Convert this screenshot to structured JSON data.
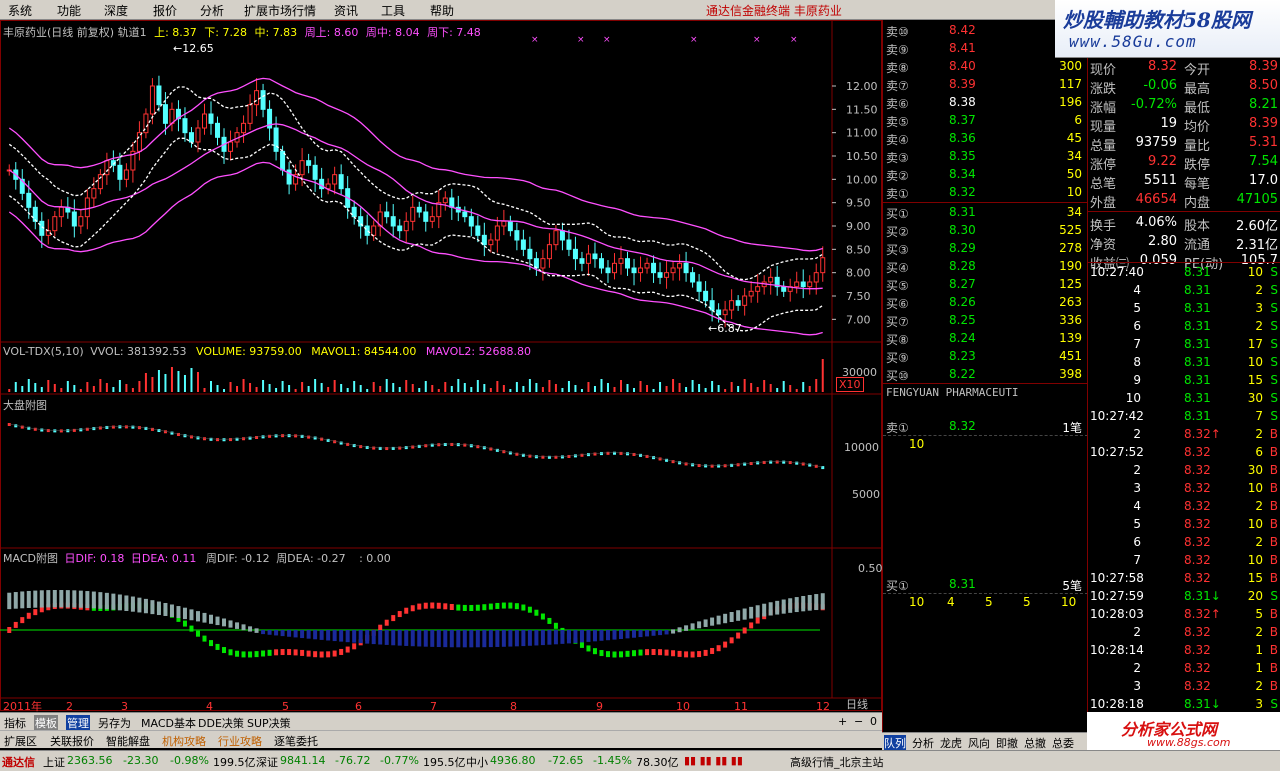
{
  "menu": {
    "items": [
      "系统",
      "功能",
      "深度",
      "报价",
      "分析",
      "扩展市场行情",
      "资讯",
      "工具",
      "帮助"
    ],
    "title": "通达信金融终端  丰原药业"
  },
  "logo": {
    "line1": "炒股輔助教材58股网",
    "line2": "www.58Gu.com"
  },
  "main_panel": {
    "title_name": "丰原药业(日线 前复权) 轨道1",
    "up_label": "上: 8.37",
    "down_label": "下: 7.28",
    "mid_label": "中: 7.83",
    "week_up": "周上: 8.60",
    "week_mid": "周中: 8.04",
    "week_down": "周下: 7.48",
    "high_marker": "12.65",
    "low_marker": "6.87"
  },
  "vol_panel": {
    "title": "VOL-TDX(5,10)",
    "vvol": "VVOL: 381392.53",
    "volume": "VOLUME: 93759.00",
    "mavol1": "MAVOL1: 84544.00",
    "mavol2": "MAVOL2: 52688.80",
    "scale": "30000",
    "mult": "X10"
  },
  "market_panel": {
    "title": "大盘附图",
    "ticks": [
      "10000",
      "5000"
    ]
  },
  "macd_panel": {
    "title": "MACD附图",
    "dif": "日DIF: 0.18",
    "dea": "日DEA: 0.11",
    "wdif": "周DIF: -0.12",
    "wdea": "周DEA: -0.27",
    "extra": ": 0.00",
    "tick": "0.50"
  },
  "x_axis": {
    "labels": [
      "2011年",
      "2",
      "3",
      "4",
      "5",
      "6",
      "7",
      "8",
      "9",
      "10",
      "11",
      "12"
    ],
    "period": "日线"
  },
  "colors": {
    "up": "#ff3232",
    "down": "#54ffff",
    "green": "#00e600",
    "magenta": "#ff50ff",
    "yellow": "#ffff00",
    "frame": "#800000"
  },
  "chart_data": {
    "type": "candlestick",
    "ylim": [
      6.6,
      12.9
    ],
    "y_ticks": [
      "12.00",
      "11.50",
      "11.00",
      "10.50",
      "10.00",
      "9.50",
      "9.00",
      "8.50",
      "8.00",
      "7.50",
      "7.00"
    ],
    "close": [
      10.2,
      10.0,
      9.7,
      9.4,
      9.1,
      8.8,
      8.9,
      9.2,
      9.4,
      9.3,
      9.0,
      9.2,
      9.6,
      9.8,
      10.1,
      10.4,
      10.3,
      10.0,
      10.2,
      10.6,
      11.0,
      11.4,
      12.0,
      11.6,
      11.2,
      11.5,
      11.3,
      11.0,
      10.8,
      11.1,
      11.4,
      11.2,
      10.9,
      10.6,
      10.8,
      11.0,
      11.2,
      11.6,
      11.9,
      11.5,
      11.1,
      10.6,
      10.2,
      9.9,
      10.1,
      10.4,
      10.3,
      10.0,
      9.8,
      9.9,
      10.1,
      9.8,
      9.4,
      9.2,
      9.0,
      8.8,
      9.0,
      9.3,
      9.2,
      9.0,
      8.9,
      9.1,
      9.4,
      9.3,
      9.1,
      9.2,
      9.5,
      9.6,
      9.4,
      9.3,
      9.2,
      9.0,
      8.8,
      8.6,
      8.7,
      9.0,
      9.1,
      8.9,
      8.7,
      8.5,
      8.3,
      8.1,
      8.3,
      8.6,
      8.9,
      8.7,
      8.5,
      8.3,
      8.2,
      8.4,
      8.3,
      8.1,
      8.0,
      8.2,
      8.3,
      8.1,
      8.0,
      8.1,
      8.2,
      8.0,
      7.9,
      8.0,
      8.1,
      8.2,
      8.0,
      7.8,
      7.6,
      7.4,
      7.2,
      7.1,
      7.2,
      7.4,
      7.3,
      7.5,
      7.6,
      7.7,
      7.8,
      7.9,
      7.7,
      7.6,
      7.7,
      7.8,
      7.7,
      7.8,
      8.0,
      8.32
    ]
  },
  "order_book": {
    "sell": [
      {
        "label": "卖⑩",
        "price": "8.42",
        "vol": ""
      },
      {
        "label": "卖⑨",
        "price": "8.41",
        "vol": ""
      },
      {
        "label": "卖⑧",
        "price": "8.40",
        "vol": "300"
      },
      {
        "label": "卖⑦",
        "price": "8.39",
        "vol": "117"
      },
      {
        "label": "卖⑥",
        "price": "8.38",
        "vol": "196"
      },
      {
        "label": "卖⑤",
        "price": "8.37",
        "vol": "6"
      },
      {
        "label": "卖④",
        "price": "8.36",
        "vol": "45"
      },
      {
        "label": "卖③",
        "price": "8.35",
        "vol": "34"
      },
      {
        "label": "卖②",
        "price": "8.34",
        "vol": "50"
      },
      {
        "label": "卖①",
        "price": "8.32",
        "vol": "10"
      }
    ],
    "buy": [
      {
        "label": "买①",
        "price": "8.31",
        "vol": "34"
      },
      {
        "label": "买②",
        "price": "8.30",
        "vol": "525"
      },
      {
        "label": "买③",
        "price": "8.29",
        "vol": "278"
      },
      {
        "label": "买④",
        "price": "8.28",
        "vol": "190"
      },
      {
        "label": "买⑤",
        "price": "8.27",
        "vol": "125"
      },
      {
        "label": "买⑥",
        "price": "8.26",
        "vol": "263"
      },
      {
        "label": "买⑦",
        "price": "8.25",
        "vol": "336"
      },
      {
        "label": "买⑧",
        "price": "8.24",
        "vol": "139"
      },
      {
        "label": "买⑨",
        "price": "8.23",
        "vol": "451"
      },
      {
        "label": "买⑩",
        "price": "8.22",
        "vol": "398"
      }
    ],
    "stock_en": "FENGYUAN PHARMACEUTI",
    "sell_queue": {
      "label": "卖①",
      "price": "8.32",
      "count": "1笔",
      "first": "10"
    },
    "buy_queue": {
      "label": "买①",
      "price": "8.31",
      "count": "5笔",
      "items": [
        "10",
        "4",
        "5",
        "5",
        "10"
      ]
    }
  },
  "quote": {
    "rows": [
      {
        "k1": "现价",
        "v1": "8.32",
        "k2": "今开",
        "v2": "8.39"
      },
      {
        "k1": "涨跌",
        "v1": "-0.06",
        "k2": "最高",
        "v2": "8.50"
      },
      {
        "k1": "涨幅",
        "v1": "-0.72%",
        "k2": "最低",
        "v2": "8.21"
      },
      {
        "k1": "现量",
        "v1": "19",
        "k2": "均价",
        "v2": "8.39"
      },
      {
        "k1": "总量",
        "v1": "93759",
        "k2": "量比",
        "v2": "5.31"
      },
      {
        "k1": "涨停",
        "v1": "9.22",
        "k2": "跌停",
        "v2": "7.54"
      },
      {
        "k1": "总笔",
        "v1": "5511",
        "k2": "每笔",
        "v2": "17.0"
      },
      {
        "k1": "外盘",
        "v1": "46654",
        "k2": "内盘",
        "v2": "47105"
      },
      {
        "k1": "换手",
        "v1": "4.06%",
        "k2": "股本",
        "v2": "2.60亿"
      },
      {
        "k1": "净资",
        "v1": "2.80",
        "k2": "流通",
        "v2": "2.31亿"
      },
      {
        "k1": "收益㈢",
        "v1": "0.059",
        "k2": "PE(动)",
        "v2": "105.7"
      }
    ],
    "ticks": [
      {
        "t": "10:27:40",
        "p": "8.31",
        "v": "10",
        "d": "S"
      },
      {
        "t": "4",
        "p": "8.31",
        "v": "2",
        "d": "S"
      },
      {
        "t": "5",
        "p": "8.31",
        "v": "3",
        "d": "S"
      },
      {
        "t": "6",
        "p": "8.31",
        "v": "2",
        "d": "S"
      },
      {
        "t": "7",
        "p": "8.31",
        "v": "17",
        "d": "S"
      },
      {
        "t": "8",
        "p": "8.31",
        "v": "10",
        "d": "S"
      },
      {
        "t": "9",
        "p": "8.31",
        "v": "15",
        "d": "S"
      },
      {
        "t": "10",
        "p": "8.31",
        "v": "30",
        "d": "S"
      },
      {
        "t": "10:27:42",
        "p": "8.31",
        "v": "7",
        "d": "S"
      },
      {
        "t": "2",
        "p": "8.32↑",
        "v": "2",
        "d": "B"
      },
      {
        "t": "10:27:52",
        "p": "8.32",
        "v": "6",
        "d": "B"
      },
      {
        "t": "2",
        "p": "8.32",
        "v": "30",
        "d": "B"
      },
      {
        "t": "3",
        "p": "8.32",
        "v": "10",
        "d": "B"
      },
      {
        "t": "4",
        "p": "8.32",
        "v": "2",
        "d": "B"
      },
      {
        "t": "5",
        "p": "8.32",
        "v": "10",
        "d": "B"
      },
      {
        "t": "6",
        "p": "8.32",
        "v": "2",
        "d": "B"
      },
      {
        "t": "7",
        "p": "8.32",
        "v": "10",
        "d": "B"
      },
      {
        "t": "10:27:58",
        "p": "8.32",
        "v": "15",
        "d": "B"
      },
      {
        "t": "10:27:59",
        "p": "8.31↓",
        "v": "20",
        "d": "S"
      },
      {
        "t": "10:28:03",
        "p": "8.32↑",
        "v": "5",
        "d": "B"
      },
      {
        "t": "2",
        "p": "8.32",
        "v": "2",
        "d": "B"
      },
      {
        "t": "10:28:14",
        "p": "8.32",
        "v": "1",
        "d": "B"
      },
      {
        "t": "2",
        "p": "8.32",
        "v": "1",
        "d": "B"
      },
      {
        "t": "3",
        "p": "8.32",
        "v": "2",
        "d": "B"
      },
      {
        "t": "10:28:18",
        "p": "8.31↓",
        "v": "3",
        "d": "S"
      }
    ]
  },
  "bottom_tabs": [
    "指标",
    "模板",
    "管理",
    "另存为",
    "MACD基本",
    "DDE决策",
    "SUP决策"
  ],
  "ext_tabs": [
    "扩展区",
    "关联报价",
    "智能解盘",
    "机构攻略",
    "行业攻略",
    "逐笔委托"
  ],
  "sidebar_tabs": [
    "队列",
    "分析",
    "龙虎",
    "风向",
    "即撤",
    "总撤",
    "总委"
  ],
  "status": {
    "brand": "通达信",
    "sh_label": "上证",
    "sh_val": "2363.56",
    "sh_chg": "-23.30",
    "sh_pct": "-0.98%",
    "sh_amt": "199.5亿",
    "sz_label": "深证",
    "sz_val": "9841.14",
    "sz_chg": "-76.72",
    "sz_pct": "-0.77%",
    "sz_amt": "195.5亿",
    "zx_label": "中小",
    "zx_val": "4936.80",
    "zx_chg": "-72.65",
    "zx_pct": "-1.45%",
    "zx_amt": "78.30亿",
    "server": "高级行情_北京主站"
  },
  "watermark": {
    "line1": "分析家公式网",
    "line2": "www.88gs.com"
  }
}
